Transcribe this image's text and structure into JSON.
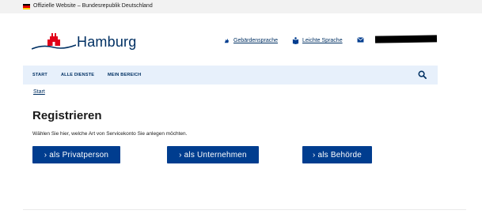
{
  "official_bar": {
    "text": "Offizielle Website – Bundesrepublik Deutschland",
    "flag_colors": [
      "#000000",
      "#dd0000",
      "#ffce00"
    ]
  },
  "header": {
    "logo_text": "Hamburg",
    "logo_color": "#e10019",
    "links": [
      {
        "label": "Gebärdensprache",
        "icon": "sign-language-icon"
      },
      {
        "label": "Leichte Sprache",
        "icon": "easy-language-icon"
      },
      {
        "label": "",
        "icon": "mail-icon"
      }
    ]
  },
  "nav": {
    "items": [
      "START",
      "ALLE DIENSTE",
      "MEIN BEREICH"
    ],
    "search_icon": "search-icon"
  },
  "breadcrumb": {
    "label": "Start"
  },
  "main": {
    "title": "Registrieren",
    "subtitle": "Wählen Sie hier, welche Art von Servicekonto Sie anlegen möchten.",
    "buttons": [
      "› als Privatperson",
      "› als Unternehmen",
      "› als Behörde"
    ]
  },
  "colors": {
    "primary": "#003d8f",
    "nav_bg": "#e7f0fb",
    "text_dark": "#003063"
  }
}
